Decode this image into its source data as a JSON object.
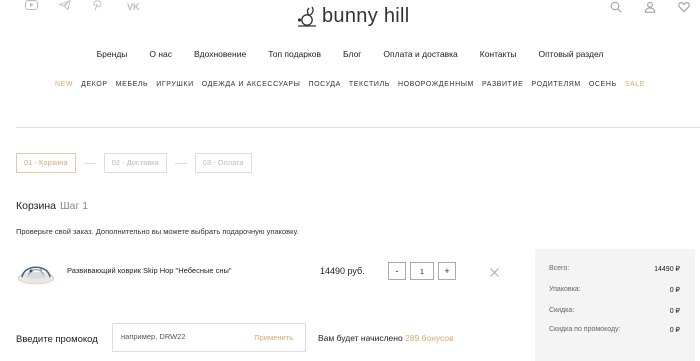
{
  "header": {
    "social_icons": [
      "youtube-icon",
      "telegram-icon",
      "pinterest-icon",
      "vk-icon"
    ],
    "vk_label": "VK",
    "logo_text": "bunny hill",
    "utility_icons": [
      "search-icon",
      "user-icon",
      "heart-icon"
    ]
  },
  "main_nav": [
    "Бренды",
    "О нас",
    "Вдохновение",
    "Топ подарков",
    "Блог",
    "Оплата и доставка",
    "Контакты",
    "Оптовый раздел"
  ],
  "category_nav": [
    {
      "label": "NEW",
      "accent": true
    },
    {
      "label": "ДЕКОР",
      "accent": false
    },
    {
      "label": "МЕБЕЛЬ",
      "accent": false
    },
    {
      "label": "ИГРУШКИ",
      "accent": false
    },
    {
      "label": "ОДЕЖДА И АКСЕССУАРЫ",
      "accent": false
    },
    {
      "label": "ПОСУДА",
      "accent": false
    },
    {
      "label": "ТЕКСТИЛЬ",
      "accent": false
    },
    {
      "label": "НОВОРОЖДЕННЫМ",
      "accent": false
    },
    {
      "label": "РАЗВИТИЕ",
      "accent": false
    },
    {
      "label": "РОДИТЕЛЯМ",
      "accent": false
    },
    {
      "label": "ОСЕНЬ",
      "accent": false
    },
    {
      "label": "SALE",
      "accent": true
    }
  ],
  "steps": [
    {
      "label": "01 - Корзина",
      "active": true
    },
    {
      "label": "02 - Доставка",
      "active": false
    },
    {
      "label": "03 - Оплата",
      "active": false
    }
  ],
  "cart": {
    "title": "Корзина",
    "step": "Шаг 1",
    "note": "Проверьте свой заказ. Дополнительно вы можете выбрать подарочную упаковку."
  },
  "item": {
    "name": "Развивающий коврик Skip Hop \"Небесные сны\"",
    "price": "14490 руб.",
    "quantity": "1",
    "minus": "-",
    "plus": "+"
  },
  "promo": {
    "label": "Введите промокод",
    "placeholder": "например, DRW22",
    "apply": "Применить",
    "bonus_prefix": "Вам будет начислено",
    "bonus_value": "289 бонусов"
  },
  "summary": [
    {
      "label": "Всего:",
      "value": "14490 ₽"
    },
    {
      "label": "Упаковка:",
      "value": "0 ₽"
    },
    {
      "label": "Скидка:",
      "value": "0 ₽"
    },
    {
      "label": "Скидка по промокоду:",
      "value": "0 ₽"
    }
  ],
  "colors": {
    "accent": "#d9a870",
    "summary_bg": "#f4f4f4",
    "border": "#dddddd"
  }
}
